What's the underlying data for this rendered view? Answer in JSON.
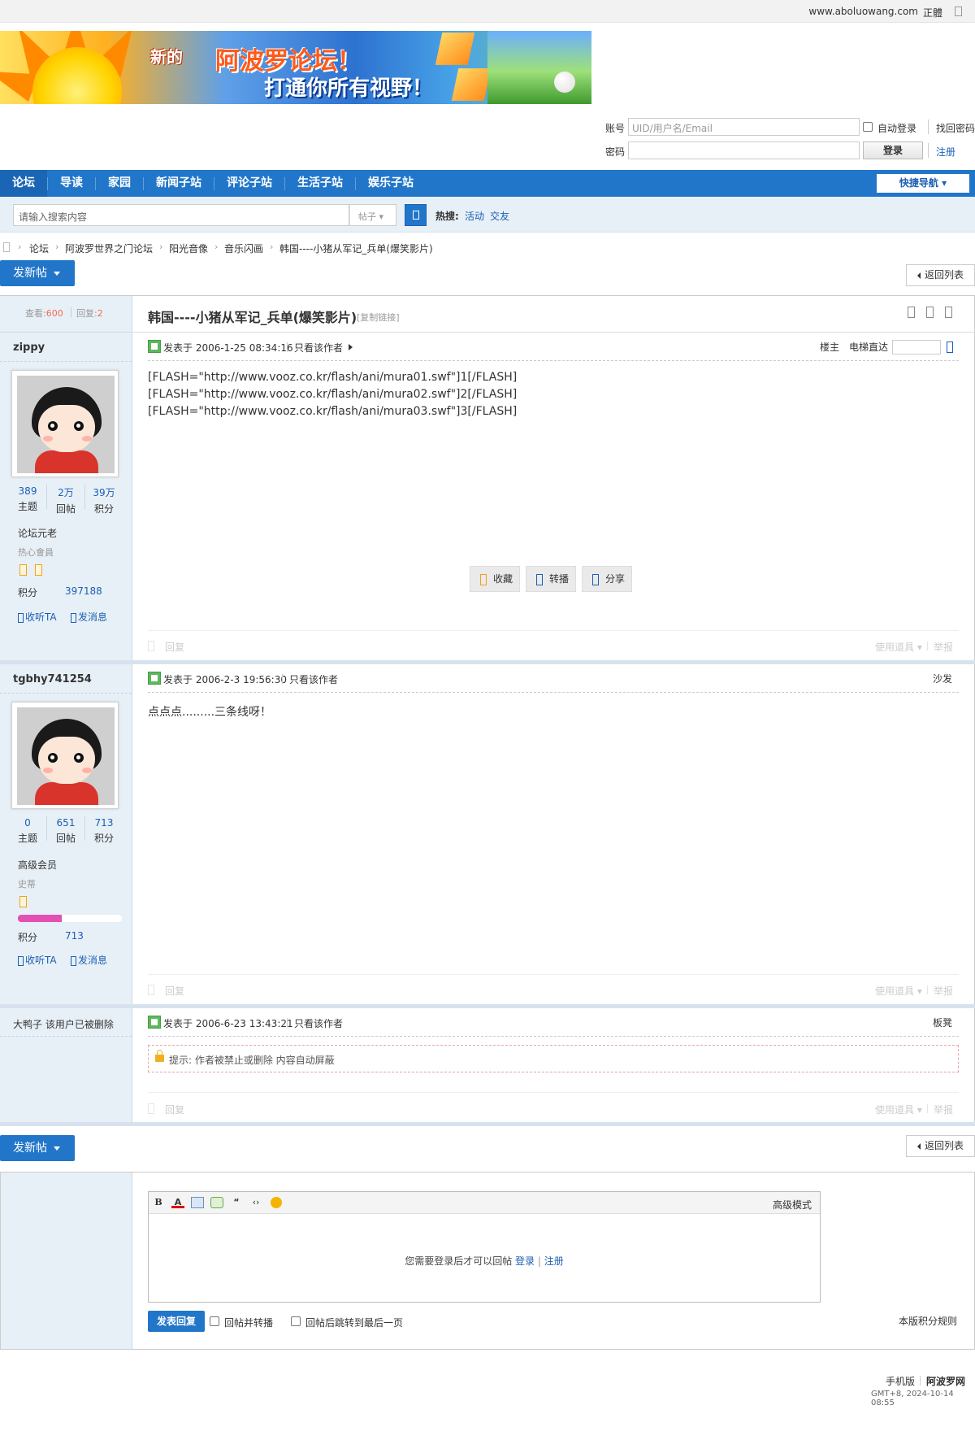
{
  "topbar": {
    "site": "www.aboluowang.com",
    "traditional": "正體"
  },
  "banner": {
    "text_new": "新的",
    "text_title": "阿波罗论坛！",
    "text_slogan": "打通你所有视野！"
  },
  "login": {
    "account_label": "账号",
    "account_placeholder": "UID/用户名/Email",
    "auto_login": "自动登录",
    "forgot": "找回密码",
    "password_label": "密码",
    "login_button": "登录",
    "register": "注册"
  },
  "nav": {
    "items": [
      "论坛",
      "导读",
      "家园",
      "新闻子站",
      "评论子站",
      "生活子站",
      "娱乐子站"
    ],
    "quick": "快捷导航"
  },
  "search": {
    "placeholder": "请输入搜索内容",
    "type": "帖子",
    "hot_label": "热搜:",
    "hot": [
      "活动",
      "交友"
    ]
  },
  "breadcrumb": [
    "论坛",
    "阿波罗世界之门论坛",
    "阳光音像",
    "音乐闪画",
    "韩国----小猪从军记_兵单(爆笑影片)"
  ],
  "buttons": {
    "new_post": "发新帖",
    "back_list": "返回列表"
  },
  "thread": {
    "views_label": "查看:",
    "views": "600",
    "replies_label": "回复:",
    "replies": "2",
    "title": "韩国----小猪从军记_兵单(爆笑影片)",
    "copy_link": "[复制链接]"
  },
  "posts": [
    {
      "author": "zippy",
      "stats": [
        {
          "n": "389",
          "l": "主题"
        },
        {
          "n": "2万",
          "l": "回帖"
        },
        {
          "n": "39万",
          "l": "积分"
        }
      ],
      "rank": "论坛元老",
      "subrank": "热心會員",
      "score_label": "积分",
      "score": "397188",
      "follow": "收听TA",
      "message": "发消息",
      "posted": "发表于 2006-1-25 08:34:16",
      "only_author": "只看该作者",
      "floor": "楼主",
      "elevator": "电梯直达",
      "lines": [
        "[FLASH=\"http://www.vooz.co.kr/flash/ani/mura01.swf\"]1[/FLASH]",
        "[FLASH=\"http://www.vooz.co.kr/flash/ani/mura02.swf\"]2[/FLASH]",
        "[FLASH=\"http://www.vooz.co.kr/flash/ani/mura03.swf\"]3[/FLASH]"
      ],
      "actions": [
        "收藏",
        "转播",
        "分享"
      ],
      "reply": "回复",
      "tools": "使用道具",
      "report": "举报"
    },
    {
      "author": "tgbhy741254",
      "stats": [
        {
          "n": "0",
          "l": "主题"
        },
        {
          "n": "651",
          "l": "回帖"
        },
        {
          "n": "713",
          "l": "积分"
        }
      ],
      "rank": "高级会员",
      "subrank": "史蒂",
      "progress": 0.42,
      "score_label": "积分",
      "score": "713",
      "follow": "收听TA",
      "message": "发消息",
      "posted": "发表于 2006-2-3 19:56:30",
      "only_author": "只看该作者",
      "floor": "沙发",
      "content": "点点点.........三条线呀！",
      "reply": "回复",
      "tools": "使用道具",
      "report": "举报"
    },
    {
      "author": "大鸭子 该用户已被删除",
      "posted": "发表于 2006-6-23 13:43:21",
      "only_author": "只看该作者",
      "floor": "板凳",
      "notice": "提示: 作者被禁止或删除 内容自动屏蔽",
      "reply": "回复",
      "tools": "使用道具",
      "report": "举报"
    }
  ],
  "reply_box": {
    "advanced": "高级模式",
    "need_login": "您需要登录后才可以回帖",
    "login": "登录",
    "register": "注册",
    "submit": "发表回复",
    "opt1": "回帖并转播",
    "opt2": "回帖后跳转到最后一页",
    "rules": "本版积分规则"
  },
  "footer": {
    "mobile": "手机版",
    "brand": "阿波罗网",
    "time": "GMT+8, 2024-10-14 08:55"
  },
  "colors": {
    "nav_blue": "#2276c9",
    "link_blue": "#1a5fb4",
    "accent_orange": "#f26c4f"
  }
}
